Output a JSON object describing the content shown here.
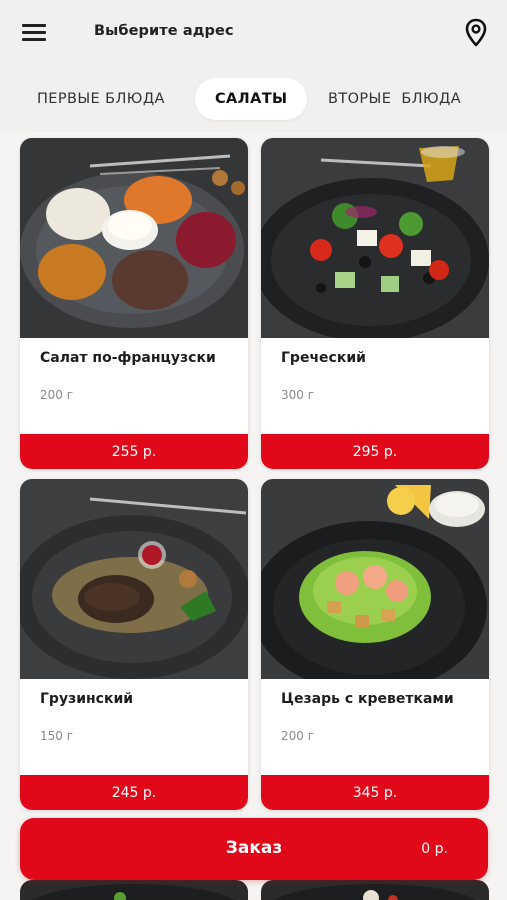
{
  "header": {
    "menu_icon": "hamburger-menu-icon",
    "address_label": "Выберите адрес",
    "location_icon": "map-pin-icon"
  },
  "tabs": [
    {
      "label": "ПЕРВЫЕ БЛЮДА",
      "active": false
    },
    {
      "label": "САЛАТЫ",
      "active": true
    },
    {
      "label": "ВТОРЫЕ  БЛЮДА",
      "active": false
    }
  ],
  "products": [
    {
      "name": "Салат по-французски",
      "weight": "200 г",
      "price": "255 р."
    },
    {
      "name": "Греческий",
      "weight": "300 г",
      "price": "295 р."
    },
    {
      "name": "Грузинский",
      "weight": "150 г",
      "price": "245 р."
    },
    {
      "name": "Цезарь с креветками",
      "weight": "200 г",
      "price": "345 р."
    }
  ],
  "order": {
    "label": "Заказ",
    "total": "0 р."
  },
  "colors": {
    "accent": "#e1081a",
    "background": "#f1f0ef",
    "card": "#ffffff"
  }
}
